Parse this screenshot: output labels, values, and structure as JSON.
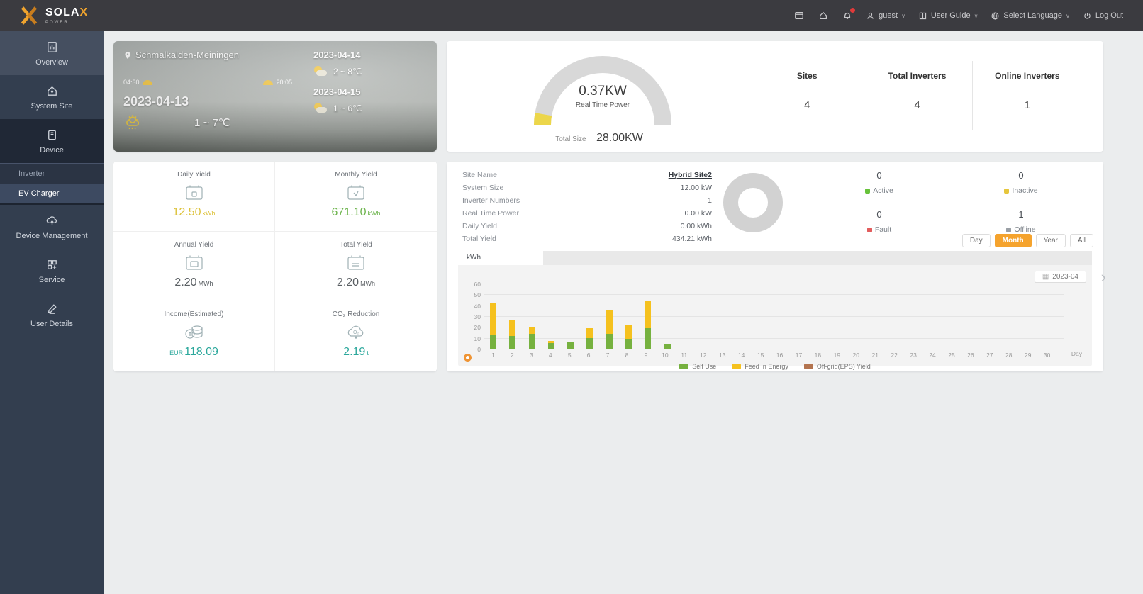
{
  "navbar": {
    "brand": "SOLA",
    "brand_x": "X",
    "brand_sub": "POWER",
    "user": "guest",
    "user_guide": "User Guide",
    "language": "Select Language",
    "logout": "Log Out"
  },
  "sidebar": {
    "overview": "Overview",
    "system_site": "System Site",
    "device": "Device",
    "inverter": "Inverter",
    "ev_charger": "EV Charger",
    "device_management": "Device Management",
    "service": "Service",
    "user_details": "User Details"
  },
  "weather": {
    "location": "Schmalkalden-Meiningen",
    "sunrise": "04:30",
    "sunset": "20:05",
    "today_date": "2023-04-13",
    "today_temp": "1 ~ 7℃",
    "forecast": [
      {
        "date": "2023-04-14",
        "temp": "2 ~ 8℃"
      },
      {
        "date": "2023-04-15",
        "temp": "1 ~ 6℃"
      }
    ]
  },
  "power": {
    "real_time_value": "0.37KW",
    "real_time_label": "Real Time Power",
    "total_size_label": "Total Size",
    "total_size_value": "28.00KW",
    "gauge_track_color": "#d8d8d8",
    "gauge_fill_color": "#ecd64a",
    "stats": [
      {
        "label": "Sites",
        "value": "4"
      },
      {
        "label": "Total Inverters",
        "value": "4"
      },
      {
        "label": "Online Inverters",
        "value": "1"
      }
    ]
  },
  "yield_panel": {
    "tiles": [
      {
        "label": "Daily Yield",
        "prefix": "",
        "value": "12.50",
        "unit": "kWh",
        "color": "#ddc23a"
      },
      {
        "label": "Monthly Yield",
        "prefix": "",
        "value": "671.10",
        "unit": "kWh",
        "color": "#6cb44c"
      },
      {
        "label": "Annual Yield",
        "prefix": "",
        "value": "2.20",
        "unit": "MWh",
        "color": "#5a5f63"
      },
      {
        "label": "Total Yield",
        "prefix": "",
        "value": "2.20",
        "unit": "MWh",
        "color": "#5a5f63"
      },
      {
        "label": "Income(Estimated)",
        "prefix": "EUR",
        "value": "118.09",
        "unit": "",
        "color": "#2ca89c"
      },
      {
        "label": "CO₂ Reduction",
        "prefix": "",
        "value": "2.19",
        "unit": "t",
        "color": "#2ca89c"
      }
    ]
  },
  "site": {
    "rows": [
      {
        "label": "Site Name",
        "value": "Hybrid Site2",
        "link": true
      },
      {
        "label": "System Size",
        "value": "12.00 kW"
      },
      {
        "label": "Inverter Numbers",
        "value": "1"
      },
      {
        "label": "Real Time Power",
        "value": "0.00 kW"
      },
      {
        "label": "Daily Yield",
        "value": "0.00 kWh"
      },
      {
        "label": "Total Yield",
        "value": "434.21 kWh"
      }
    ],
    "statuses": [
      {
        "count": "0",
        "label": "Active",
        "color": "#67c23a"
      },
      {
        "count": "0",
        "label": "Inactive",
        "color": "#e6c63c"
      },
      {
        "count": "0",
        "label": "Fault",
        "color": "#e25c5c"
      },
      {
        "count": "1",
        "label": "Offline",
        "color": "#9a9fa5"
      }
    ],
    "range_tabs": [
      {
        "label": "Day",
        "active": false
      },
      {
        "label": "Month",
        "active": true
      },
      {
        "label": "Year",
        "active": false
      },
      {
        "label": "All",
        "active": false
      }
    ],
    "active_tab_color": "#f5a32d",
    "date_value": "2023-04",
    "unit_tab": "kWh"
  },
  "chart_data": {
    "type": "bar",
    "stacked": true,
    "title": "Monthly yield by day (kWh)",
    "x": [
      1,
      2,
      3,
      4,
      5,
      6,
      7,
      8,
      9,
      10,
      11,
      12,
      13,
      14,
      15,
      16,
      17,
      18,
      19,
      20,
      21,
      22,
      23,
      24,
      25,
      26,
      27,
      28,
      29,
      30
    ],
    "xlabel": "Day",
    "ylabel": "kWh",
    "ylim": [
      0,
      60
    ],
    "yticks": [
      0,
      10,
      20,
      30,
      40,
      50,
      60
    ],
    "grid": true,
    "legend_position": "bottom",
    "series": [
      {
        "name": "Self Use",
        "color": "#76b13f",
        "values": [
          13,
          12,
          14,
          5,
          6,
          10,
          14,
          9,
          19,
          4,
          0,
          0,
          0,
          0,
          0,
          0,
          0,
          0,
          0,
          0,
          0,
          0,
          0,
          0,
          0,
          0,
          0,
          0,
          0,
          0
        ]
      },
      {
        "name": "Feed In Energy",
        "color": "#f5c11e",
        "values": [
          29,
          14,
          6,
          2,
          0,
          9,
          22,
          13,
          25,
          0,
          0,
          0,
          0,
          0,
          0,
          0,
          0,
          0,
          0,
          0,
          0,
          0,
          0,
          0,
          0,
          0,
          0,
          0,
          0,
          0
        ]
      },
      {
        "name": "Off-grid(EPS) Yield",
        "color": "#b3744f",
        "values": [
          0,
          0,
          0,
          0,
          0,
          0,
          0,
          0,
          0,
          0,
          0,
          0,
          0,
          0,
          0,
          0,
          0,
          0,
          0,
          0,
          0,
          0,
          0,
          0,
          0,
          0,
          0,
          0,
          0,
          0
        ]
      }
    ]
  }
}
